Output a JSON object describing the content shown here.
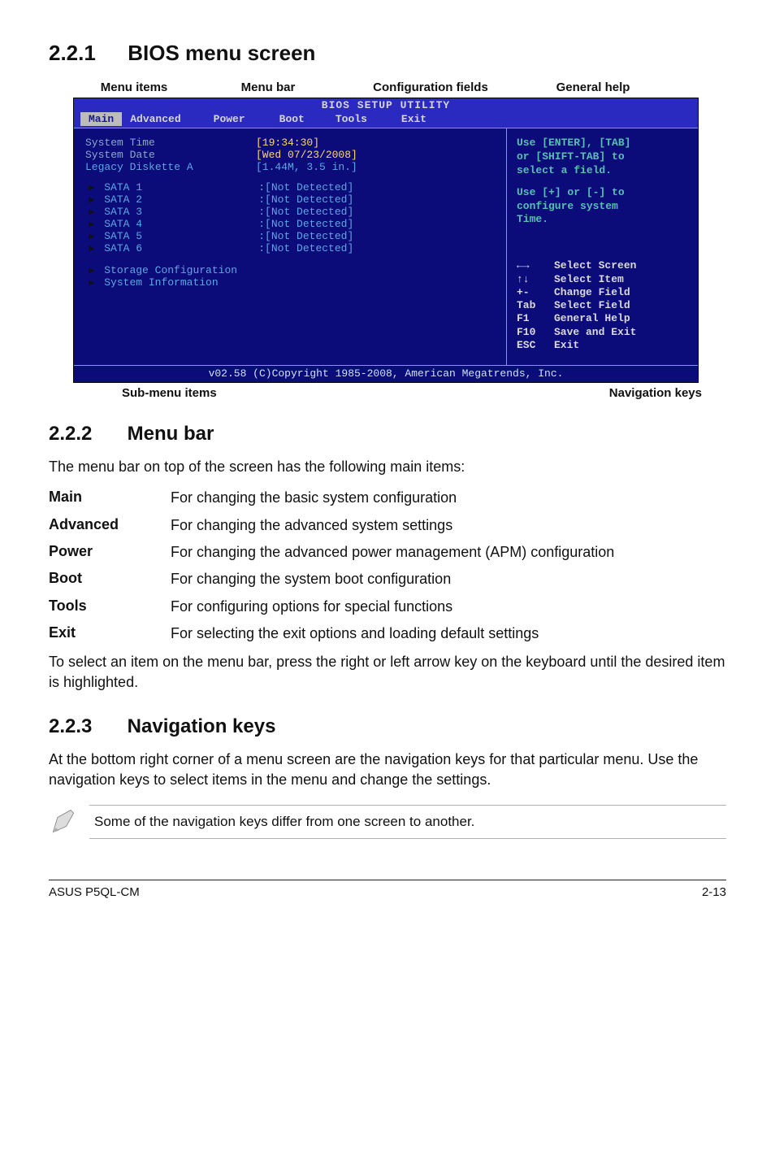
{
  "section221": {
    "num": "2.2.1",
    "title": "BIOS menu screen"
  },
  "section222": {
    "num": "2.2.2",
    "title": "Menu bar",
    "intro": "The menu bar on top of the screen has the following main items:",
    "outro": "To select an item on the menu bar, press the right or left arrow key on the keyboard until the desired item is highlighted."
  },
  "section223": {
    "num": "2.2.3",
    "title": "Navigation keys",
    "body": "At the bottom right corner of a menu screen are the navigation keys for that particular menu. Use the navigation keys to select items in the menu and change the settings."
  },
  "annotations": {
    "menu_items": "Menu items",
    "menu_bar": "Menu bar",
    "config_fields": "Configuration fields",
    "general_help": "General help",
    "sub_menu": "Sub-menu items",
    "nav_keys": "Navigation keys"
  },
  "bios": {
    "title": "BIOS SETUP UTILITY",
    "tabs": [
      "Main",
      "Advanced",
      "Power",
      "Boot",
      "Tools",
      "Exit"
    ],
    "active_tab": "Main",
    "fields": [
      {
        "label": "System Time",
        "value": "[19:34:30]",
        "class": "gray"
      },
      {
        "label": "System Date",
        "value": "[Wed 07/23/2008]",
        "class": "gray"
      },
      {
        "label": "Legacy Diskette A",
        "value": "[1.44M, 3.5 in.]",
        "class": ""
      }
    ],
    "sata": [
      {
        "name": "SATA 1",
        "value": ":[Not Detected]"
      },
      {
        "name": "SATA 2",
        "value": ":[Not Detected]"
      },
      {
        "name": "SATA 3",
        "value": ":[Not Detected]"
      },
      {
        "name": "SATA 4",
        "value": ":[Not Detected]"
      },
      {
        "name": "SATA 5",
        "value": ":[Not Detected]"
      },
      {
        "name": "SATA 6",
        "value": ":[Not Detected]"
      }
    ],
    "submenus": [
      "Storage Configuration",
      "System Information"
    ],
    "help": {
      "l1": "Use [ENTER], [TAB]",
      "l2": "or [SHIFT-TAB] to",
      "l3": "select a field.",
      "l4": "Use [+] or [-] to",
      "l5": "configure system",
      "l6": "Time."
    },
    "nav": [
      {
        "key": "←→",
        "desc": "Select Screen"
      },
      {
        "key": "↑↓",
        "desc": "Select Item"
      },
      {
        "key": "+-",
        "desc": "Change Field"
      },
      {
        "key": "Tab",
        "desc": "Select Field"
      },
      {
        "key": "F1",
        "desc": "General Help"
      },
      {
        "key": "F10",
        "desc": "Save and Exit"
      },
      {
        "key": "ESC",
        "desc": "Exit"
      }
    ],
    "footer": "v02.58 (C)Copyright 1985-2008, American Megatrends, Inc."
  },
  "menubar_items": [
    {
      "name": "Main",
      "desc": "For changing the basic system configuration"
    },
    {
      "name": "Advanced",
      "desc": "For changing the advanced system settings"
    },
    {
      "name": "Power",
      "desc": "For changing the advanced power management (APM) configuration"
    },
    {
      "name": "Boot",
      "desc": "For changing the system boot configuration"
    },
    {
      "name": "Tools",
      "desc": "For configuring options for special functions"
    },
    {
      "name": "Exit",
      "desc": "For selecting the exit options and loading default settings"
    }
  ],
  "note": "Some of the navigation keys differ from one screen to another.",
  "footer": {
    "left": "ASUS P5QL-CM",
    "right": "2-13"
  }
}
